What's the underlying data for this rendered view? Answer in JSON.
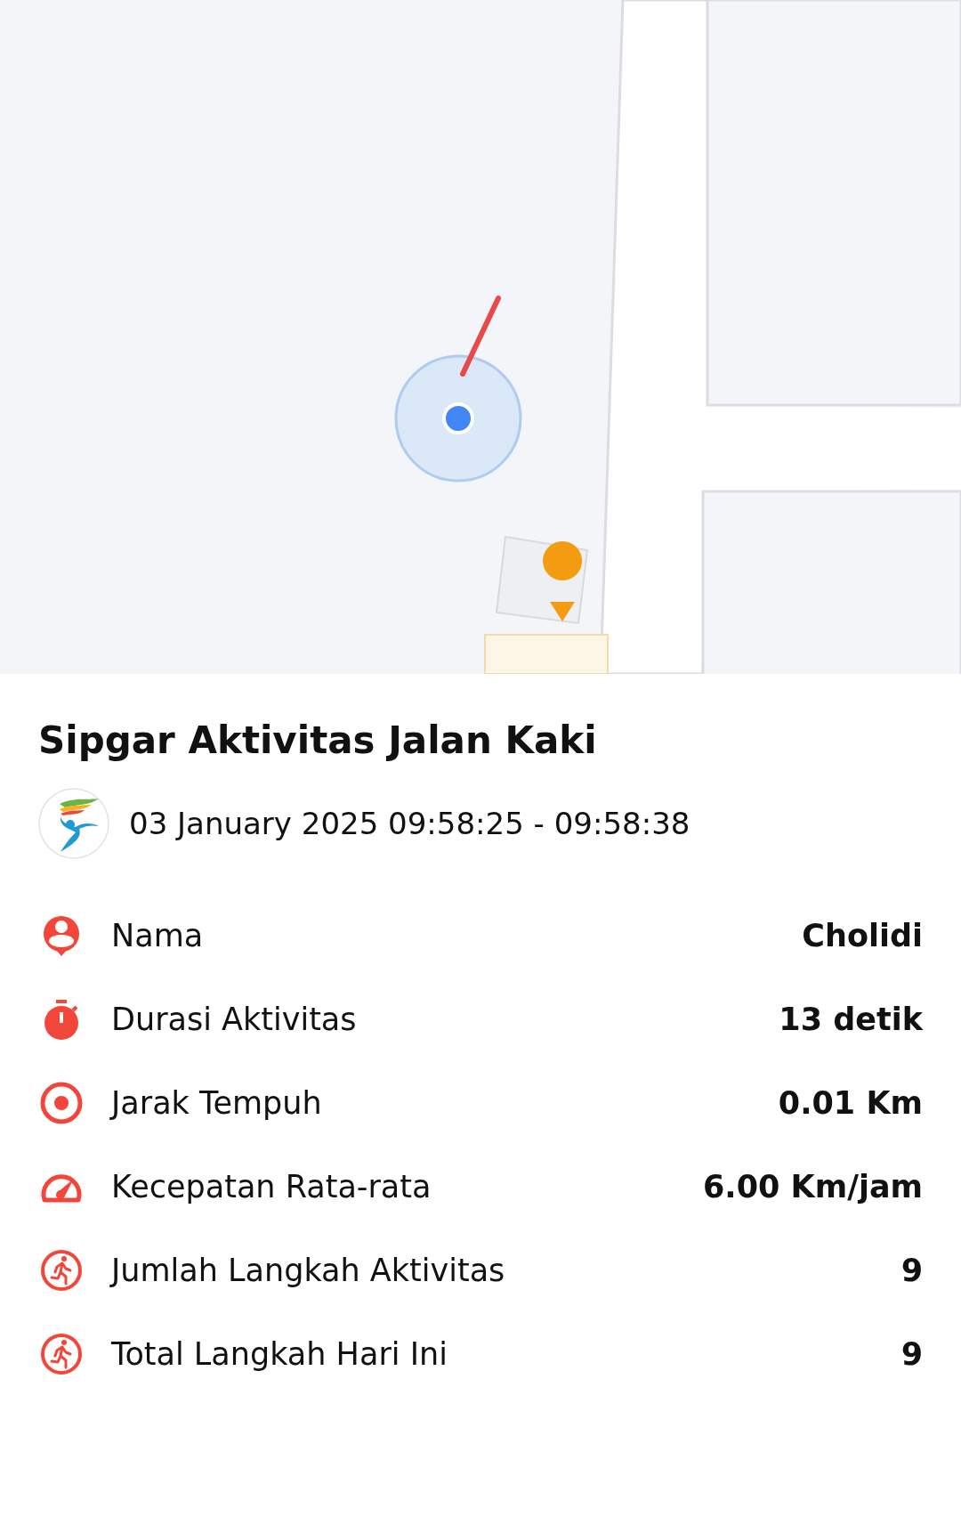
{
  "title": "Sipgar Aktivitas Jalan Kaki",
  "time_range": "03 January 2025 09:58:25 - 09:58:38",
  "stats": [
    {
      "kind": "person",
      "label": "Nama",
      "value": "Cholidi"
    },
    {
      "kind": "timer",
      "label": "Durasi Aktivitas",
      "value": "13 detik"
    },
    {
      "kind": "target",
      "label": "Jarak Tempuh",
      "value": "0.01 Km"
    },
    {
      "kind": "speed",
      "label": "Kecepatan Rata-rata",
      "value": "6.00 Km/jam"
    },
    {
      "kind": "walk",
      "label": "Jumlah Langkah Aktivitas",
      "value": "9"
    },
    {
      "kind": "walk",
      "label": "Total Langkah Hari Ini",
      "value": "9"
    }
  ]
}
